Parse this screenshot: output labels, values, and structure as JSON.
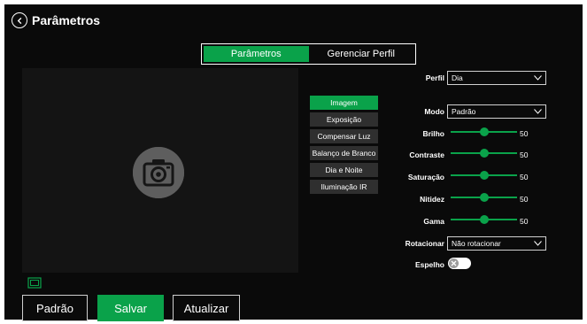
{
  "header": {
    "title": "Parâmetros"
  },
  "tabs": [
    {
      "label": "Parâmetros",
      "active": true
    },
    {
      "label": "Gerenciar Perfil",
      "active": false
    }
  ],
  "menu": [
    {
      "label": "Imagem",
      "active": true
    },
    {
      "label": "Exposição",
      "active": false
    },
    {
      "label": "Compensar Luz",
      "active": false
    },
    {
      "label": "Balanço de Branco",
      "active": false
    },
    {
      "label": "Dia e Noite",
      "active": false
    },
    {
      "label": "Iluminação IR",
      "active": false
    }
  ],
  "settings": {
    "profile": {
      "label": "Perfil",
      "value": "Dia"
    },
    "mode": {
      "label": "Modo",
      "value": "Padrão"
    },
    "sliders": [
      {
        "key": "brightness",
        "label": "Brilho",
        "value": 50
      },
      {
        "key": "contrast",
        "label": "Contraste",
        "value": 50
      },
      {
        "key": "saturation",
        "label": "Saturação",
        "value": 50
      },
      {
        "key": "sharpness",
        "label": "Nitidez",
        "value": 50
      },
      {
        "key": "gamma",
        "label": "Gama",
        "value": 50
      }
    ],
    "rotate": {
      "label": "Rotacionar",
      "value": "Não rotacionar"
    },
    "mirror": {
      "label": "Espelho",
      "on": false
    }
  },
  "buttons": {
    "default": "Padrão",
    "save": "Salvar",
    "refresh": "Atualizar"
  },
  "colors": {
    "accent": "#0aa24a",
    "background": "#0a0a0a",
    "menu_item": "#2f2f2f"
  },
  "icons": {
    "back": "chevron-left-circle-icon",
    "camera": "camera-icon",
    "fit": "fit-screen-icon",
    "toggle": "close-icon",
    "dropdown": "chevron-down-icon"
  }
}
